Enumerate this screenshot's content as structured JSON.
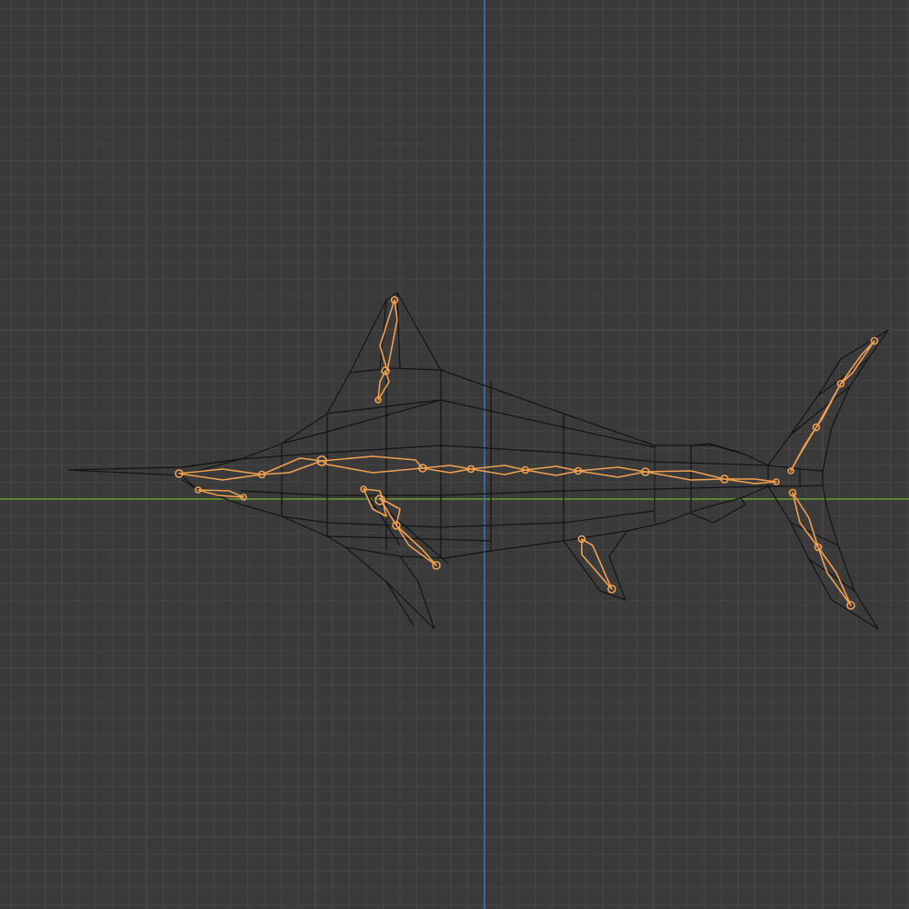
{
  "viewport": {
    "background": "#3a3a3a",
    "grid_minor_color": "#454545",
    "grid_major_color": "#4e4e4e",
    "axis_x_color": "#6d9b2f",
    "axis_z_color": "#3f76b5"
  },
  "scene": {
    "object": "marlin-mesh-wireframe",
    "armature": "fish-rig",
    "mesh_color": "#141414",
    "bone_color": "#f0a050",
    "bone_groups": [
      "spine",
      "dorsal-fin",
      "pectoral-fin",
      "pelvic-fin",
      "anal-fin",
      "tail-upper",
      "tail-lower",
      "jaw"
    ]
  }
}
